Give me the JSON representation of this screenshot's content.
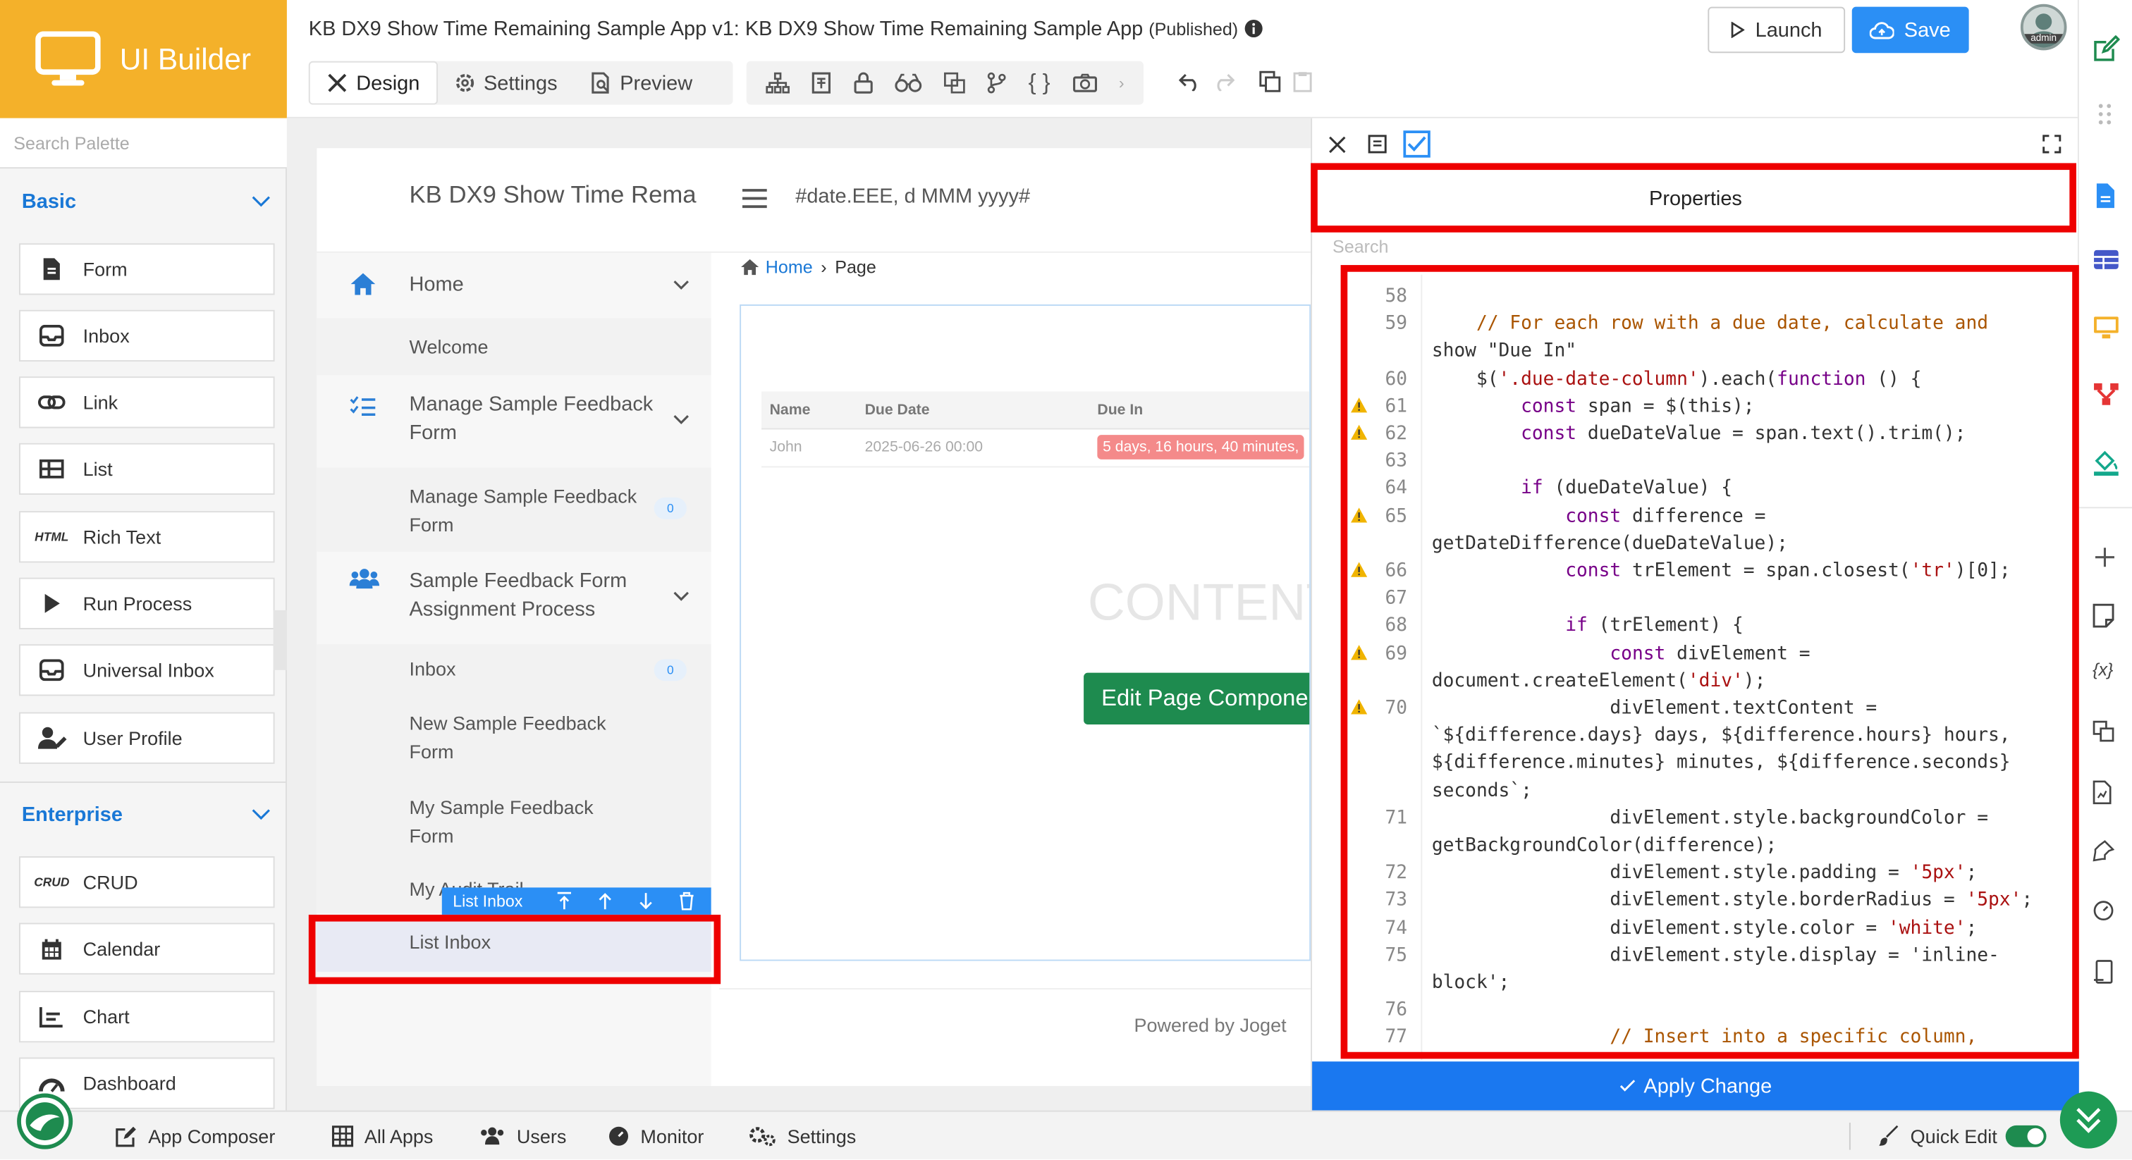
{
  "brand": {
    "name": "UI Builder",
    "color": "#f4b12a"
  },
  "palette": {
    "search_placeholder": "Search Palette",
    "sections": [
      {
        "title": "Basic",
        "items": [
          {
            "label": "Form",
            "icon": "form-icon"
          },
          {
            "label": "Inbox",
            "icon": "inbox-icon"
          },
          {
            "label": "Link",
            "icon": "link-icon"
          },
          {
            "label": "List",
            "icon": "list-icon"
          },
          {
            "label": "Rich Text",
            "icon_text": "HTML"
          },
          {
            "label": "Run Process",
            "icon": "play-icon"
          },
          {
            "label": "Universal Inbox",
            "icon": "inbox-icon"
          },
          {
            "label": "User Profile",
            "icon": "user-edit-icon"
          }
        ]
      },
      {
        "title": "Enterprise",
        "items": [
          {
            "label": "CRUD",
            "icon_text": "CRUD"
          },
          {
            "label": "Calendar",
            "icon": "calendar-icon"
          },
          {
            "label": "Chart",
            "icon": "chart-icon"
          },
          {
            "label": "Dashboard",
            "icon": "dashboard-icon"
          }
        ]
      }
    ]
  },
  "header": {
    "title": "KB DX9 Show Time Remaining Sample App v1: KB DX9 Show Time Remaining Sample App",
    "status": "(Published)",
    "tabs": [
      {
        "label": "Design",
        "active": true
      },
      {
        "label": "Settings",
        "active": false
      },
      {
        "label": "Preview",
        "active": false
      }
    ],
    "launch_label": "Launch",
    "save_label": "Save",
    "avatar_text": "admin"
  },
  "canvas": {
    "page_title": "KB DX9 Show Time Rema",
    "date_format": "#date.EEE, d MMM yyyy#",
    "breadcrumb": {
      "home": "Home",
      "current": "Page"
    },
    "menu": [
      {
        "label": "Home",
        "type": "category"
      },
      {
        "label": "Welcome",
        "type": "item"
      },
      {
        "label": "Manage Sample Feedback Form",
        "type": "category"
      },
      {
        "label": "Manage Sample Feedback Form",
        "type": "item",
        "badge": "0"
      },
      {
        "label": "Sample Feedback Form Assignment Process",
        "type": "category"
      },
      {
        "label": "Inbox",
        "type": "item",
        "badge": "0"
      },
      {
        "label": "New Sample Feedback Form",
        "type": "item"
      },
      {
        "label": "My Sample Feedback Form",
        "type": "item"
      },
      {
        "label": "My Audit Trail",
        "type": "item"
      },
      {
        "label": "List Inbox",
        "type": "item",
        "selected": true
      }
    ],
    "selected_toolbar_label": "List Inbox",
    "table": {
      "headers": [
        "Name",
        "Due Date",
        "Due In"
      ],
      "rows": [
        {
          "name": "John",
          "due_date": "2025-06-26 00:00",
          "due_in": "5 days, 16 hours, 40 minutes,"
        }
      ]
    },
    "watermark": "CONTENT",
    "edit_button": "Edit Page Component",
    "footer": "Powered by Joget"
  },
  "properties": {
    "title": "Properties",
    "search_placeholder": "Search",
    "apply_label": "Apply Change",
    "code_lines": [
      {
        "n": "58",
        "w": false,
        "t": ""
      },
      {
        "n": "59",
        "w": false,
        "t": "    // For each row with a due date, calculate and"
      },
      {
        "n": "",
        "w": false,
        "t": "show \"Due In\""
      },
      {
        "n": "60",
        "w": false,
        "t": "    $('.due-date-column').each(function () {"
      },
      {
        "n": "61",
        "w": true,
        "t": "        const span = $(this);"
      },
      {
        "n": "62",
        "w": true,
        "t": "        const dueDateValue = span.text().trim();"
      },
      {
        "n": "63",
        "w": false,
        "t": ""
      },
      {
        "n": "64",
        "w": false,
        "t": "        if (dueDateValue) {"
      },
      {
        "n": "65",
        "w": true,
        "t": "            const difference ="
      },
      {
        "n": "",
        "w": false,
        "t": "getDateDifference(dueDateValue);"
      },
      {
        "n": "66",
        "w": true,
        "t": "            const trElement = span.closest('tr')[0];"
      },
      {
        "n": "67",
        "w": false,
        "t": ""
      },
      {
        "n": "68",
        "w": false,
        "t": "            if (trElement) {"
      },
      {
        "n": "69",
        "w": true,
        "t": "                const divElement ="
      },
      {
        "n": "",
        "w": false,
        "t": "document.createElement('div');"
      },
      {
        "n": "70",
        "w": true,
        "t": "                divElement.textContent ="
      },
      {
        "n": "",
        "w": false,
        "t": "`${difference.days} days, ${difference.hours} hours,"
      },
      {
        "n": "",
        "w": false,
        "t": "${difference.minutes} minutes, ${difference.seconds}"
      },
      {
        "n": "",
        "w": false,
        "t": "seconds`;"
      },
      {
        "n": "71",
        "w": false,
        "t": "                divElement.style.backgroundColor ="
      },
      {
        "n": "",
        "w": false,
        "t": "getBackgroundColor(difference);"
      },
      {
        "n": "72",
        "w": false,
        "t": "                divElement.style.padding = '5px';"
      },
      {
        "n": "73",
        "w": false,
        "t": "                divElement.style.borderRadius = '5px';"
      },
      {
        "n": "74",
        "w": false,
        "t": "                divElement.style.color = 'white';"
      },
      {
        "n": "75",
        "w": false,
        "t": "                divElement.style.display = 'inline-"
      },
      {
        "n": "",
        "w": false,
        "t": "block';"
      },
      {
        "n": "76",
        "w": false,
        "t": ""
      },
      {
        "n": "77",
        "w": false,
        "t": "                // Insert into a specific column,"
      }
    ]
  },
  "bottom_bar": {
    "items": [
      "App Composer",
      "All Apps",
      "Users",
      "Monitor",
      "Settings"
    ],
    "quick_edit": "Quick Edit",
    "quick_edit_on": true
  },
  "colors": {
    "accent": "#2b8ff5",
    "apply": "#1a78f0",
    "highlight": "#ee0000",
    "green": "#1e8b4f",
    "due_badge": "#f48a8a"
  }
}
